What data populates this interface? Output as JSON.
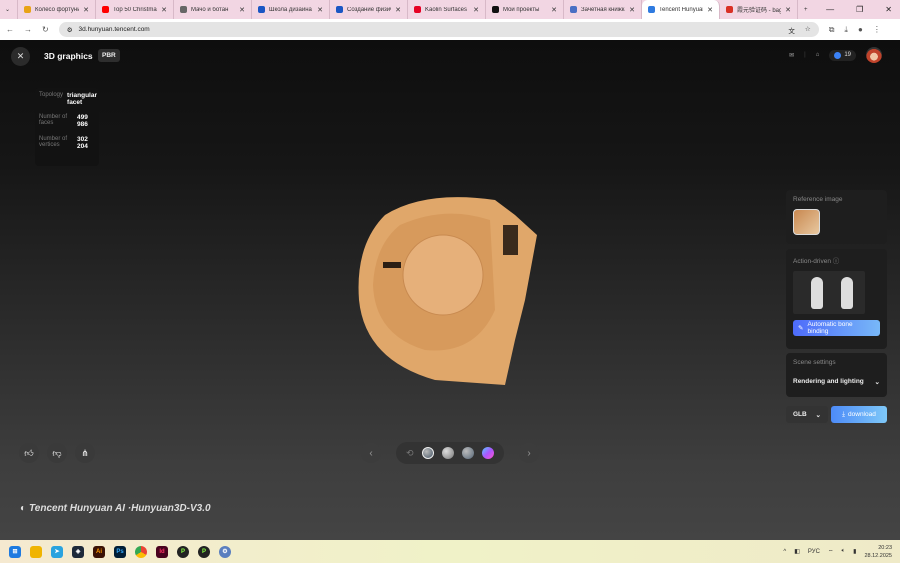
{
  "browser": {
    "tabs": [
      {
        "label": "Колесо фортуны",
        "color": "#e8a317"
      },
      {
        "label": "Top 50 Christmas",
        "color": "#ff0000"
      },
      {
        "label": "Мачо и ботан",
        "color": "#666666"
      },
      {
        "label": "Школа дизайна",
        "color": "#1a56c4"
      },
      {
        "label": "Создание физич",
        "color": "#1a56c4"
      },
      {
        "label": "Kaolin Surfaces",
        "color": "#e60023"
      },
      {
        "label": "Мои проекты",
        "color": "#111111"
      },
      {
        "label": "Зачетная книжка",
        "color": "#4a6fc4"
      },
      {
        "label": "Tencent Hunyuan",
        "color": "#2f7be0"
      },
      {
        "label": "霞元验证码 - bag",
        "color": "#d93025"
      }
    ],
    "new_tab": "+",
    "url": "3d.hunyuan.tencent.com"
  },
  "header": {
    "close": "✕",
    "title": "3D graphics",
    "badge": "PBR",
    "credits": "19"
  },
  "info": {
    "topology_label": "Topology",
    "topology_value": "triangular facet",
    "faces_label": "Number of faces",
    "faces_value": "499 986",
    "vertices_label": "Number of vertices",
    "vertices_value": "302 204"
  },
  "side": {
    "reference_label": "Reference image",
    "action_label": "Action-driven",
    "bone_button": "Automatic bone binding",
    "scene_label": "Scene settings",
    "rendering_label": "Rendering and lighting",
    "format": "GLB",
    "download": "download"
  },
  "brand": "Tencent Hunyuan AI ·Hunyuan3D-V3.0",
  "tray": {
    "lang": "РУС",
    "time": "20:23",
    "date": "28.12.2025"
  },
  "colors": {
    "model": "#e0a76a",
    "accent": "#4d6bfa"
  }
}
